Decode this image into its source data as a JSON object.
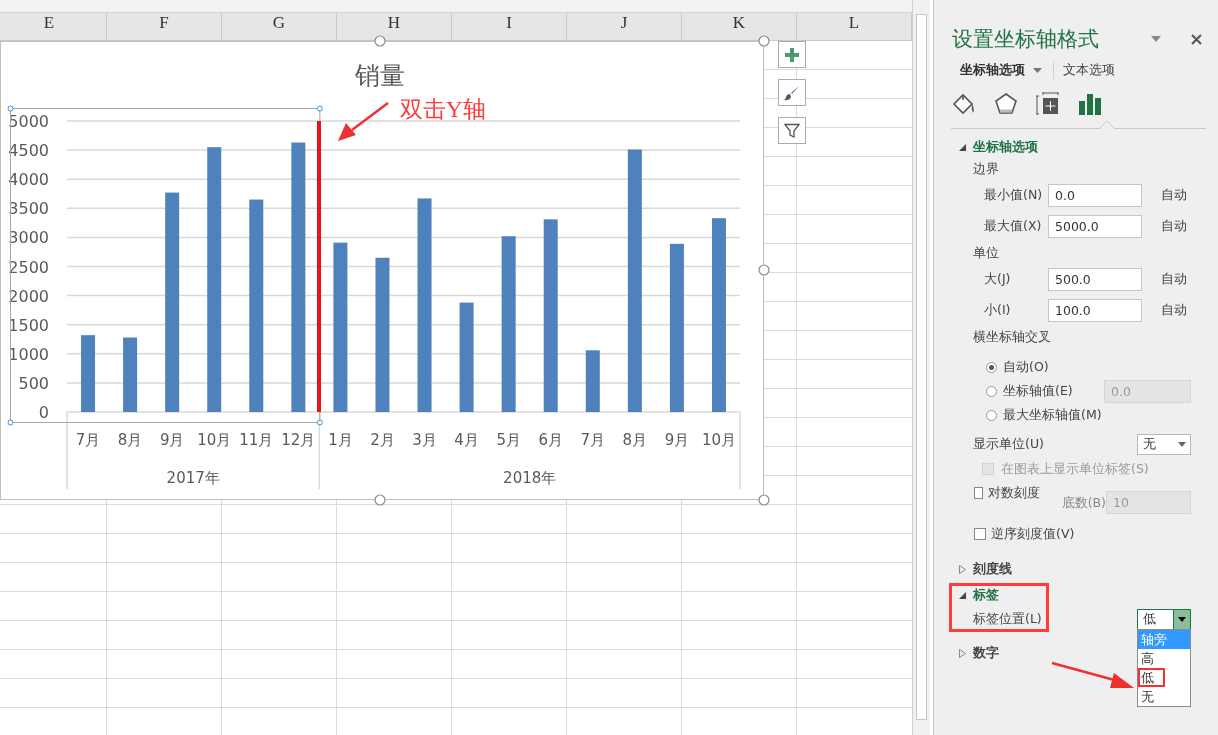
{
  "sheet": {
    "columns": [
      "E",
      "F",
      "G",
      "H",
      "I",
      "J",
      "K",
      "L"
    ]
  },
  "chart": {
    "axis_selected": true,
    "chart_data": {
      "type": "bar",
      "title": "销量",
      "categories": [
        "7月",
        "8月",
        "9月",
        "10月",
        "11月",
        "12月",
        "1月",
        "2月",
        "3月",
        "4月",
        "5月",
        "6月",
        "7月",
        "8月",
        "9月",
        "10月"
      ],
      "values": [
        1320,
        1280,
        3770,
        4550,
        3650,
        4630,
        2910,
        2650,
        3670,
        1880,
        3020,
        3310,
        1060,
        4510,
        2890,
        3330
      ],
      "ylim": [
        0,
        5000
      ],
      "yticks": [
        0,
        500,
        1000,
        1500,
        2000,
        2500,
        3000,
        3500,
        4000,
        4500,
        5000
      ],
      "grid": true,
      "annotations": [
        {
          "text": "双击Y轴"
        }
      ]
    },
    "category_groups": [
      {
        "label": "2017年"
      },
      {
        "label": "2018年"
      }
    ]
  },
  "pane": {
    "title": "设置坐标轴格式",
    "tabs": [
      {
        "label": "坐标轴选项",
        "selected": true
      },
      {
        "label": "文本选项",
        "selected": false
      }
    ],
    "icon_tabs": [
      {
        "kind": "fill",
        "selected": false
      },
      {
        "kind": "effects",
        "selected": false
      },
      {
        "kind": "size",
        "selected": false
      },
      {
        "kind": "axis",
        "selected": true
      }
    ],
    "sections": [
      {
        "title": "坐标轴选项",
        "expanded": true,
        "callout": false,
        "items": [
          {
            "kind": "heading",
            "label": "边界"
          },
          {
            "kind": "field",
            "label": "最小值(N)",
            "value": "0.0",
            "auto": "自动"
          },
          {
            "kind": "field",
            "label": "最大值(X)",
            "value": "5000.0",
            "auto": "自动"
          },
          {
            "kind": "heading",
            "label": "单位"
          },
          {
            "kind": "field",
            "label": "大(J)",
            "value": "500.0",
            "auto": "自动"
          },
          {
            "kind": "field",
            "label": "小(I)",
            "value": "100.0",
            "auto": "自动"
          },
          {
            "kind": "heading",
            "label": "横坐标轴交叉"
          },
          {
            "kind": "radio",
            "label": "自动(O)",
            "selected": true
          },
          {
            "kind": "radio",
            "label": "坐标轴值(E)",
            "selected": false,
            "value": "0.0",
            "field_disabled": true
          },
          {
            "kind": "radio",
            "label": "最大坐标轴值(M)",
            "selected": false
          },
          {
            "kind": "dropdown",
            "label": "显示单位(U)",
            "value": "无",
            "expanded": false,
            "children": [
              {
                "kind": "checkbox",
                "label": "在图表上显示单位标签(S)",
                "checked": false,
                "disabled": true
              }
            ]
          },
          {
            "kind": "checkbox",
            "label": "对数刻度",
            "checked": false,
            "disabled": false,
            "field_label": "底数(B)",
            "field_value": "10",
            "field_disabled": true
          },
          {
            "kind": "checkbox",
            "label": "逆序刻度值(V)",
            "checked": false,
            "disabled": false
          }
        ]
      },
      {
        "title": "刻度线",
        "expanded": false,
        "callout": false
      },
      {
        "title": "标签",
        "expanded": true,
        "callout": true,
        "items": [
          {
            "kind": "dropdown",
            "label": "标签位置(L)",
            "value": "低",
            "expanded": true,
            "options": [
              {
                "label": "轴旁",
                "highlighted": true,
                "callout": false
              },
              {
                "label": "高",
                "highlighted": false,
                "callout": false
              },
              {
                "label": "低",
                "highlighted": false,
                "callout": true
              },
              {
                "label": "无",
                "highlighted": false,
                "callout": false
              }
            ]
          }
        ]
      },
      {
        "title": "数字",
        "expanded": false,
        "callout": false
      }
    ]
  }
}
